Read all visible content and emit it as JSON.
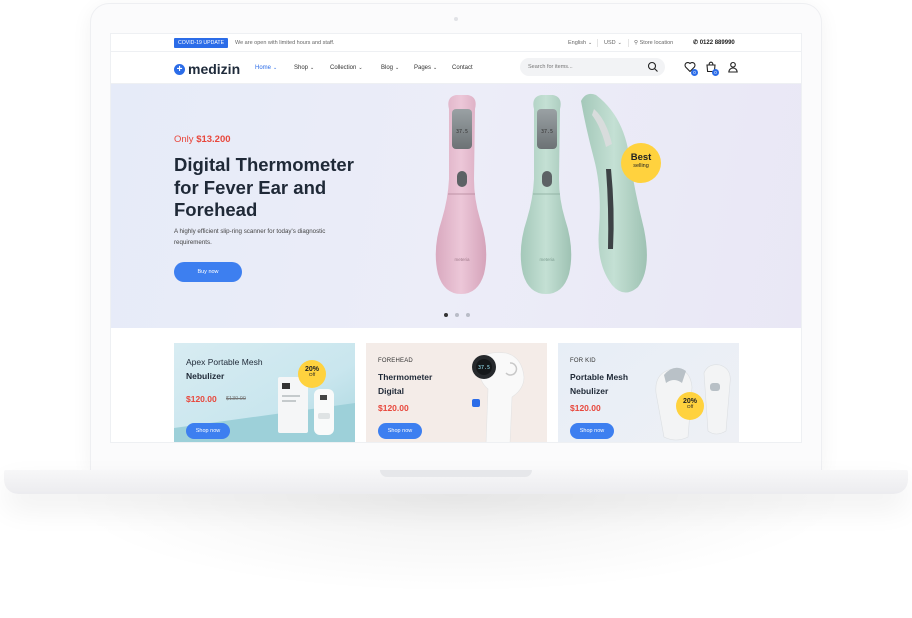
{
  "topbar": {
    "covid_badge": "COVID-19 UPDATE",
    "covid_text": "We are open with limited hours and staff.",
    "language": "English",
    "currency": "USD",
    "store_location": "Store location",
    "phone": "0122 889990"
  },
  "nav": {
    "logo": "medizin",
    "items": [
      {
        "label": "Home",
        "active": true
      },
      {
        "label": "Shop"
      },
      {
        "label": "Collection"
      },
      {
        "label": "Blog"
      },
      {
        "label": "Pages"
      },
      {
        "label": "Contact"
      }
    ],
    "search_placeholder": "Search for items...",
    "wishlist_count": "0",
    "cart_count": "0"
  },
  "hero": {
    "price_prefix": "Only",
    "price": "$13.200",
    "title": "Digital Thermometer for Fever Ear and Forehead",
    "description": "A highly efficient slip-ring scanner for today's diagnostic requirements.",
    "cta": "Buy now",
    "badge_line1": "Best",
    "badge_line2": "selling",
    "device_brand": "meteria"
  },
  "cards": [
    {
      "tag": "",
      "title_line1": "Apex Portable Mesh",
      "title_line2": "Nebulizer",
      "price": "$120.00",
      "old_price": "$130.00",
      "discount": "20%",
      "discount_label": "Off",
      "cta": "Shop now"
    },
    {
      "tag": "FOREHEAD",
      "title_line1": "Thermometer",
      "title_line2": "Digital",
      "price": "$120.00",
      "cta": "Shop now",
      "display_reading": "37.5"
    },
    {
      "tag": "FOR KID",
      "title_line1": "Portable Mesh",
      "title_line2": "Nebulizer",
      "price": "$120.00",
      "discount": "20%",
      "discount_label": "Off",
      "cta": "Shop now"
    }
  ],
  "colors": {
    "accent": "#2b6ce8",
    "price_red": "#e8473c",
    "badge_yellow": "#ffd23e",
    "device_pink": "#e7bfd0",
    "device_mint": "#b9d9cc"
  }
}
